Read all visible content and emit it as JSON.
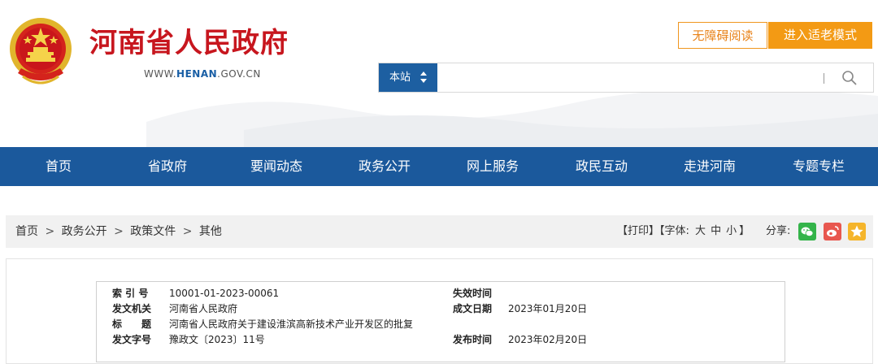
{
  "header": {
    "title": "河南省人民政府",
    "url_prefix": "WWW.",
    "url_domain": "HENAN",
    "url_suffix": ".GOV.CN",
    "accessibility_label": "无障碍阅读",
    "elder_mode_label": "进入适老模式"
  },
  "search": {
    "scope_label": "本站",
    "placeholder": "",
    "value": ""
  },
  "nav": {
    "items": [
      "首页",
      "省政府",
      "要闻动态",
      "政务公开",
      "网上服务",
      "政民互动",
      "走进河南",
      "专题专栏"
    ]
  },
  "breadcrumb": {
    "items": [
      "首页",
      "政务公开",
      "政策文件",
      "其他"
    ],
    "separator": ">"
  },
  "tools": {
    "print_label": "【打印】",
    "font_label": "【字体:",
    "font_large": "大",
    "font_medium": "中",
    "font_small": "小",
    "font_close": "】",
    "share_label": "分享:",
    "share_icons": [
      "wechat-icon",
      "weibo-icon",
      "qzone-icon"
    ]
  },
  "document_meta": {
    "index_label": "索 引 号",
    "index_value": "10001-01-2023-00061",
    "expiry_label": "失效时间",
    "expiry_value": "",
    "issuer_label": "发文机关",
    "issuer_value": "河南省人民政府",
    "created_label": "成文日期",
    "created_value": "2023年01月20日",
    "title_label": "标　　题",
    "title_value": "河南省人民政府关于建设淮滨高新技术产业开发区的批复",
    "doc_no_label": "发文字号",
    "doc_no_value": "豫政文〔2023〕11号",
    "published_label": "发布时间",
    "published_value": "2023年02月20日"
  },
  "colors": {
    "brand_red": "#c7161e",
    "nav_blue": "#1b599c",
    "accent_orange": "#f39a14"
  }
}
